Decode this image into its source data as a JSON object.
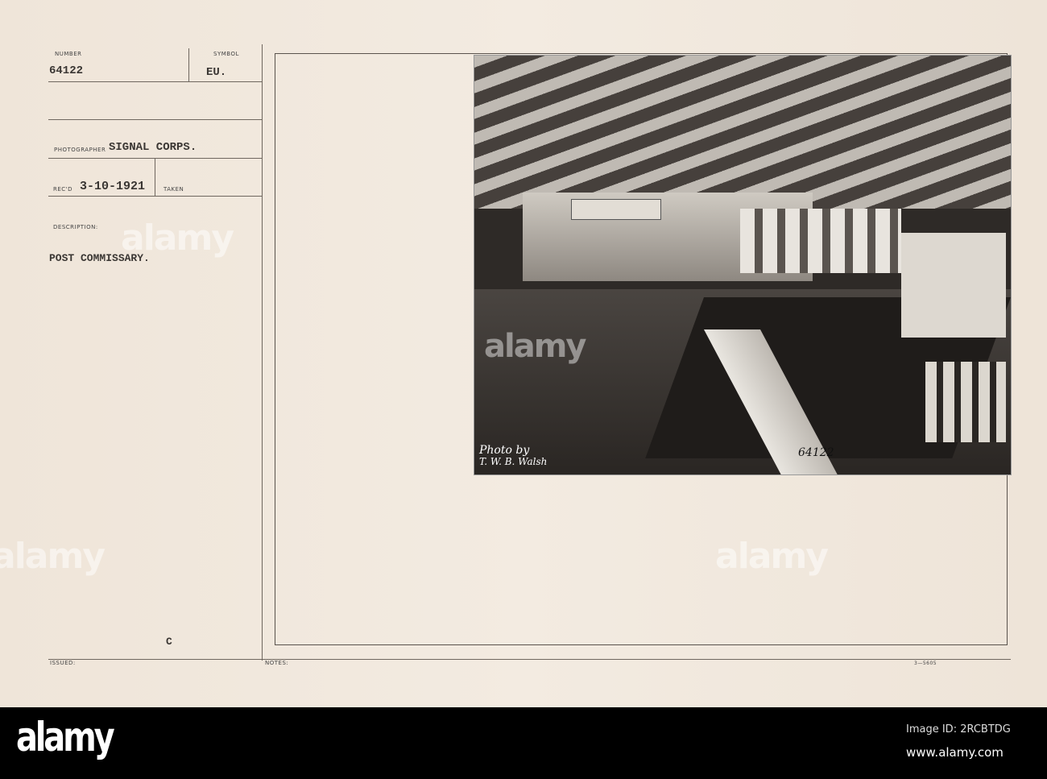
{
  "card": {
    "number_label": "NUMBER",
    "number": "64122",
    "symbol_label": "SYMBOL",
    "symbol": "EU.",
    "photographer_label": "PHOTOGRAPHER",
    "photographer": "SIGNAL CORPS.",
    "recd_label": "REC'D",
    "recd": "3-10-1921",
    "taken_label": "TAKEN",
    "description_label": "DESCRIPTION:",
    "description": "POST COMMISSARY.",
    "issued_label": "ISSUED:",
    "issued_mark": "C",
    "notes_label": "NOTES:",
    "form_number": "3—5605"
  },
  "photo": {
    "credit_line1": "Photo by",
    "credit_line2": "T. W. B. Walsh",
    "handwritten_number": "64122"
  },
  "watermark": {
    "brand": "alamy",
    "image_id": "Image ID: 2RCBTDG",
    "url": "www.alamy.com"
  }
}
